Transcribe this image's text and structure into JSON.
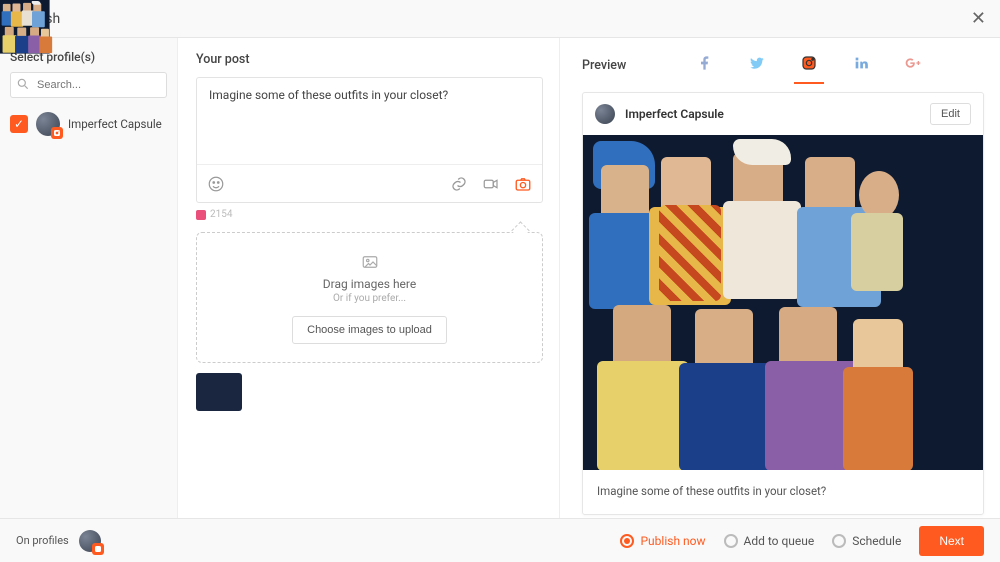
{
  "header": {
    "title": "Publish"
  },
  "sidebar": {
    "heading": "Select profile(s)",
    "search_placeholder": "Search...",
    "profiles": [
      {
        "name": "Imperfect Capsule",
        "network": "instagram",
        "selected": true
      }
    ]
  },
  "compose": {
    "heading": "Your post",
    "text": "Imagine some of these outfits in your closet?",
    "char_count": "2154",
    "dropzone": {
      "title": "Drag images here",
      "subtitle": "Or if you prefer...",
      "button": "Choose images to upload"
    }
  },
  "preview": {
    "heading": "Preview",
    "networks": [
      "facebook",
      "twitter",
      "instagram",
      "linkedin",
      "googleplus"
    ],
    "active_network": "instagram",
    "account_name": "Imperfect Capsule",
    "edit_label": "Edit",
    "caption": "Imagine some of these outfits in your closet?"
  },
  "footer": {
    "on_profiles_label": "On profiles",
    "radios": [
      {
        "id": "publish_now",
        "label": "Publish now",
        "selected": true
      },
      {
        "id": "add_to_queue",
        "label": "Add to queue",
        "selected": false
      },
      {
        "id": "schedule",
        "label": "Schedule",
        "selected": false
      }
    ],
    "next_label": "Next"
  },
  "icons": {
    "emoji": "emoji-icon",
    "link": "link-icon",
    "video": "video-icon",
    "camera": "camera-icon",
    "image": "image-icon"
  }
}
